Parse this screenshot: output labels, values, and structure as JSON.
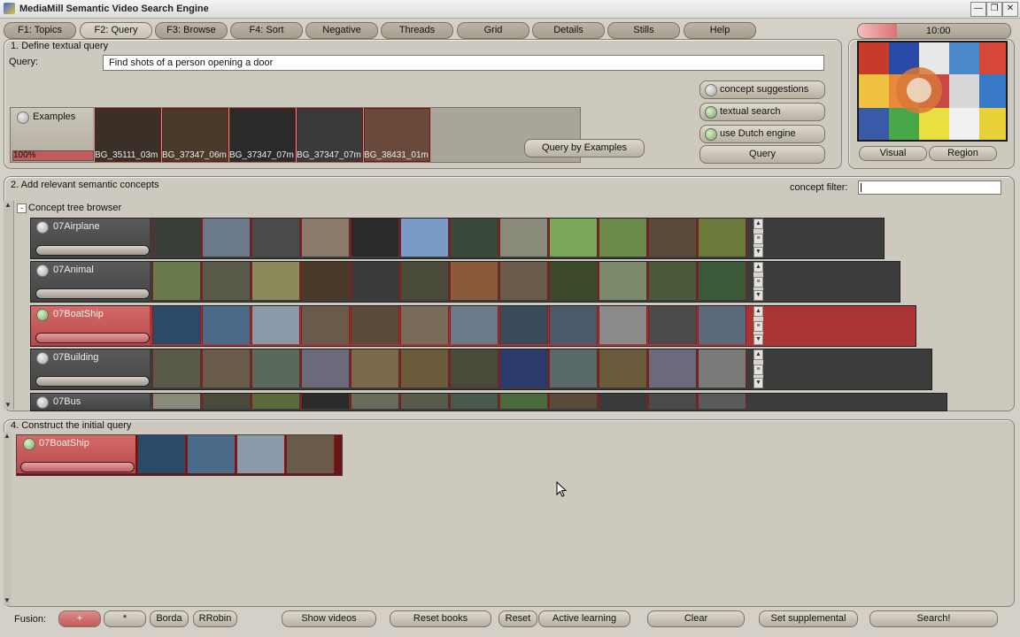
{
  "window": {
    "title": "MediaMill Semantic Video Search Engine",
    "clock": "10:00"
  },
  "tabs": [
    "F1: Topics",
    "F2: Query",
    "F3: Browse",
    "F4: Sort",
    "Negative",
    "Threads",
    "Grid",
    "Details",
    "Stills",
    "Help"
  ],
  "active_tab": "F2: Query",
  "section1": {
    "heading": "1. Define textual query",
    "query_label": "Query:",
    "query_value": "Find shots of a person opening a door",
    "examples_label": "Examples",
    "examples_percent": "100%",
    "example_captions": [
      "BG_35111_03m",
      "BG_37347_06m",
      "BG_37347_07m",
      "BG_37347_07m",
      "BG_38431_01m"
    ],
    "query_by_examples": "Query by Examples",
    "options": [
      "concept suggestions",
      "textual search",
      "use Dutch engine"
    ],
    "query_button": "Query"
  },
  "visual": {
    "visual_button": "Visual",
    "region_button": "Region"
  },
  "section2": {
    "heading": "2. Add relevant semantic concepts",
    "filter_label": "concept filter:",
    "filter_value": "",
    "tree_label": "Concept tree browser",
    "rows": [
      {
        "name": "07Airplane",
        "selected": false
      },
      {
        "name": "07Animal",
        "selected": false
      },
      {
        "name": "07BoatShip",
        "selected": true
      },
      {
        "name": "07Building",
        "selected": false
      },
      {
        "name": "07Bus",
        "selected": false
      }
    ]
  },
  "section4": {
    "heading": "4. Construct the initial query",
    "concept": "07BoatShip"
  },
  "bottom": {
    "fusion_label": "Fusion:",
    "fusion_buttons": [
      "+",
      "*",
      "Borda",
      "RRobin"
    ],
    "actions": [
      "Show videos",
      "Reset books",
      "Reset",
      "Active learning",
      "Clear",
      "Set supplemental",
      "Search!"
    ]
  },
  "colors": {
    "accent_red": "#b84848",
    "panel": "#cec9bf",
    "dark_row": "#3c3c3c"
  }
}
